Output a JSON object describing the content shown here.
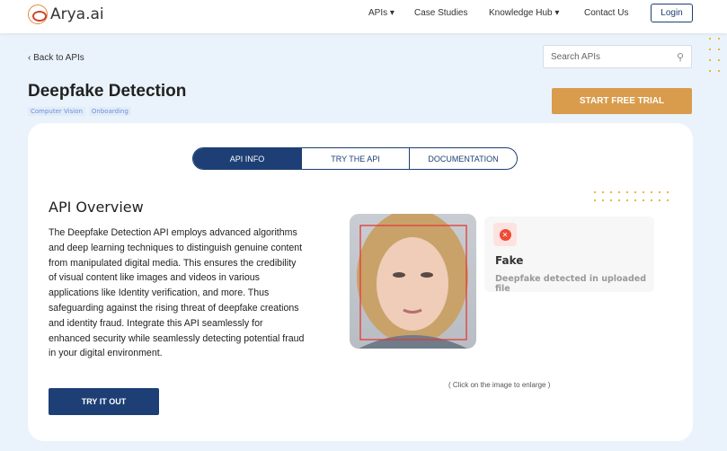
{
  "nav": {
    "logo": "Arya.ai",
    "items": [
      {
        "label": "APIs ▾"
      },
      {
        "label": "Case Studies"
      },
      {
        "label": "Knowledge Hub ▾"
      },
      {
        "label": "Contact Us"
      }
    ],
    "login": "Login"
  },
  "back": "‹  Back to APIs",
  "search": {
    "placeholder": "Search APIs",
    "icon": "search-icon"
  },
  "title": "Deepfake Detection",
  "tags": [
    "Computer Vision",
    "Onboarding"
  ],
  "start_trial": "START FREE TRIAL",
  "tabs": [
    "API INFO",
    "TRY THE API",
    "DOCUMENTATION"
  ],
  "overview": {
    "heading": "API Overview",
    "text": "The Deepfake Detection API employs advanced algorithms and deep learning techniques to distinguish genuine content from manipulated digital media. This ensures the credibility of visual content like images and videos in various applications like Identity verification, and more. Thus safeguarding against the rising threat of deepfake creations and identity fraud. Integrate this API seamlessly for enhanced security while seamlessly detecting potential fraud in your digital environment.",
    "button": "TRY IT OUT"
  },
  "result": {
    "label": "Fake",
    "subtitle": "Deepfake detected in uploaded file",
    "icon": "x-circle-icon",
    "color": "#ee4b35"
  },
  "hint": "( Click on the image to enlarge )",
  "colors": {
    "primary": "#1d3f75",
    "accent": "#d89c4c",
    "background": "#eaf3fb"
  }
}
